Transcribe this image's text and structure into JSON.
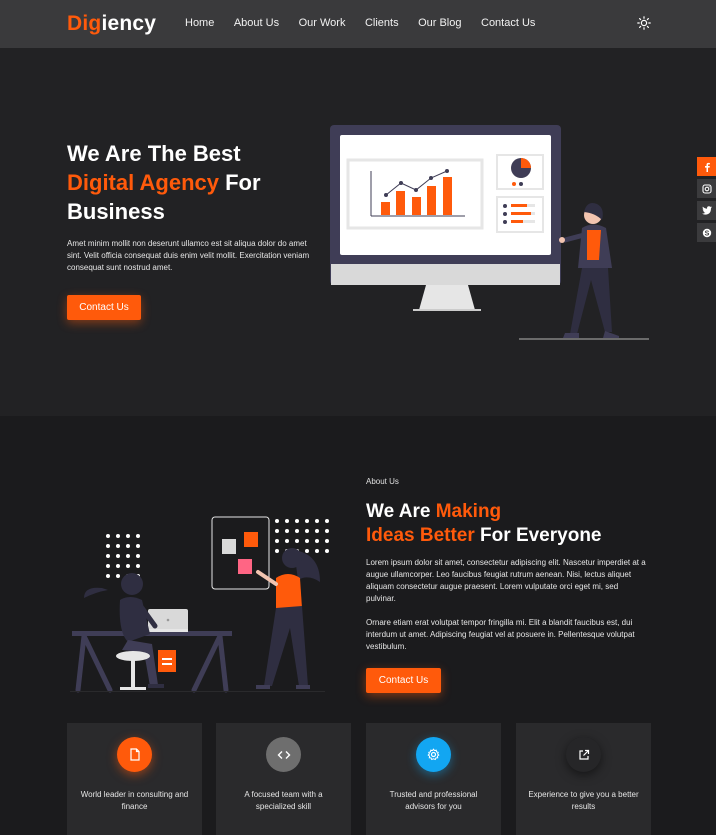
{
  "brand": {
    "logo_accent": "Dig",
    "logo_rest": "iency",
    "accent_color": "#ff5a0b"
  },
  "nav": {
    "items": [
      {
        "label": "Home"
      },
      {
        "label": "About Us"
      },
      {
        "label": "Our Work"
      },
      {
        "label": "Clients"
      },
      {
        "label": "Our Blog"
      },
      {
        "label": "Contact Us"
      }
    ],
    "theme_icon": "sun-icon"
  },
  "hero": {
    "title_line1": "We Are The Best",
    "title_orange": "Digital Agency",
    "title_for": " For",
    "title_line3": "Business",
    "text": "Amet minim mollit non deserunt ullamco est sit aliqua dolor do amet sint. Velit officia consequat duis enim velit mollit. Exercitation veniam consequat sunt nostrud amet.",
    "button_label": "Contact Us"
  },
  "social": [
    {
      "icon": "facebook-icon"
    },
    {
      "icon": "instagram-icon"
    },
    {
      "icon": "twitter-icon"
    },
    {
      "icon": "skype-icon"
    }
  ],
  "about": {
    "label": "About Us",
    "title_we_are": "We Are ",
    "title_making": "Making",
    "title_ideas": "Ideas Better",
    "title_rest": " For Everyone",
    "paragraph1": "Lorem ipsum dolor sit amet, consectetur adipiscing elit. Nascetur imperdiet at a augue ullamcorper. Leo faucibus feugiat rutrum aenean. Nisi, lectus aliquet aliquam consectetur augue praesent. Lorem vulputate orci eget mi, sed pulvinar.",
    "paragraph2": "Ornare etiam erat volutpat tempor fringilla mi. Elit a blandit faucibus est, dui interdum ut amet. Adipiscing feugiat vel at posuere in. Pellentesque volutpat vestibulum.",
    "button_label": "Contact Us"
  },
  "features": [
    {
      "icon": "document-icon",
      "color": "#ff5a0b",
      "text": "World leader in consulting and finance"
    },
    {
      "icon": "code-icon",
      "color": "#6e6e6e",
      "text": "A focused team with a specialized skill"
    },
    {
      "icon": "gear-icon",
      "color": "#12a6f2",
      "text": "Trusted and professional advisors for you"
    },
    {
      "icon": "external-link-icon",
      "color": "#262628",
      "text": "Experience to give you a better results"
    }
  ]
}
